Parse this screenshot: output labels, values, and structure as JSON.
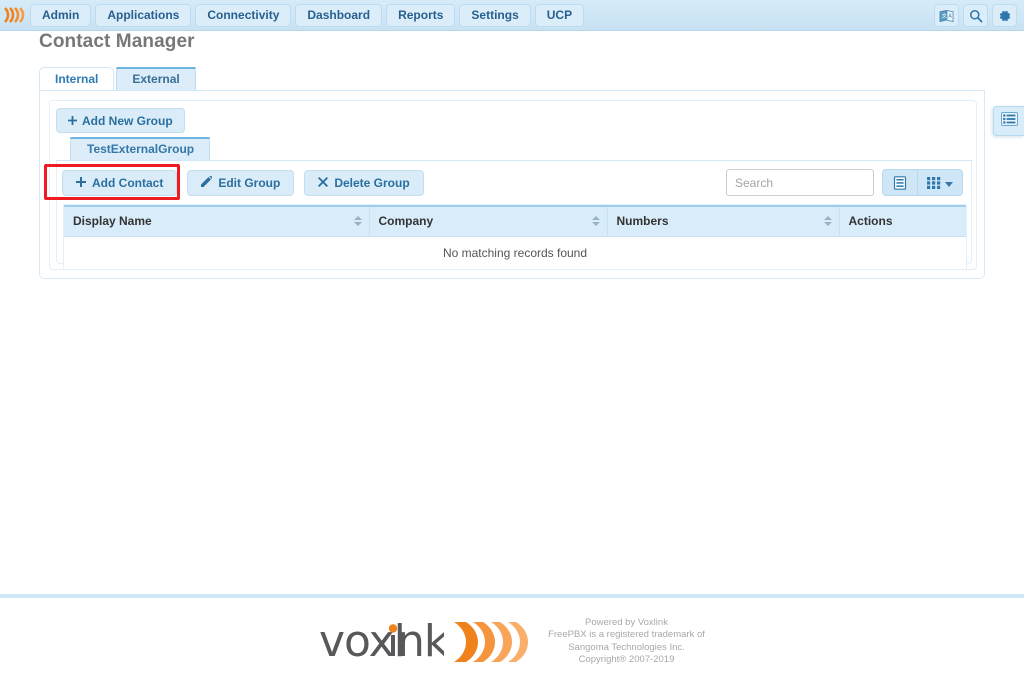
{
  "navbar": {
    "logo_icon": "voxlink-waves-logo",
    "items": [
      {
        "label": "Admin",
        "name": "nav-item-admin"
      },
      {
        "label": "Applications",
        "name": "nav-item-applications"
      },
      {
        "label": "Connectivity",
        "name": "nav-item-connectivity"
      },
      {
        "label": "Dashboard",
        "name": "nav-item-dashboard"
      },
      {
        "label": "Reports",
        "name": "nav-item-reports"
      },
      {
        "label": "Settings",
        "name": "nav-item-settings"
      },
      {
        "label": "UCP",
        "name": "nav-item-ucp"
      }
    ],
    "right_icons": [
      {
        "name": "language-icon",
        "title": "Language"
      },
      {
        "name": "search-icon",
        "title": "Search"
      },
      {
        "name": "gear-icon",
        "title": "Settings"
      }
    ],
    "colors": {
      "background": "#cfe5f4",
      "text": "#27608f",
      "button": "#dcedfa"
    }
  },
  "page": {
    "title": "Contact Manager",
    "title_color": "#77777a"
  },
  "tabs": [
    {
      "label": "Internal",
      "active": false
    },
    {
      "label": "External",
      "active": true
    }
  ],
  "group_panel": {
    "add_new_group_label": "Add New Group",
    "add_new_group_icon": "plus-icon",
    "group_tabs": [
      {
        "label": "TestExternalGroup",
        "active": true
      }
    ]
  },
  "actions": [
    {
      "label": "Add Contact",
      "icon": "plus-icon",
      "name": "add-contact-button",
      "highlighted": true
    },
    {
      "label": "Edit Group",
      "icon": "pencil-icon",
      "name": "edit-group-button",
      "highlighted": false
    },
    {
      "label": "Delete Group",
      "icon": "times-icon",
      "name": "delete-group-button",
      "highlighted": false
    }
  ],
  "search": {
    "placeholder": "Search",
    "value": ""
  },
  "table_tools": [
    {
      "name": "list-view-icon",
      "label": ""
    },
    {
      "name": "column-visibility-grid-icon",
      "label": ""
    }
  ],
  "table": {
    "columns": [
      {
        "label": "Display Name",
        "sortable": true
      },
      {
        "label": "Company",
        "sortable": true
      },
      {
        "label": "Numbers",
        "sortable": true
      },
      {
        "label": "Actions",
        "sortable": false
      }
    ],
    "rows": [],
    "empty_message": "No matching records found"
  },
  "side_float": {
    "icon": "list-panel-icon"
  },
  "footer": {
    "logo_text": "voxlink",
    "logo_accent_color": "#f0821e",
    "lines": [
      "Powered by Voxlink",
      "FreePBX is a registered trademark of",
      "Sangoma Technologies Inc.",
      "Copyright® 2007-2019"
    ]
  },
  "highlight": {
    "color": "#ee1b22"
  }
}
